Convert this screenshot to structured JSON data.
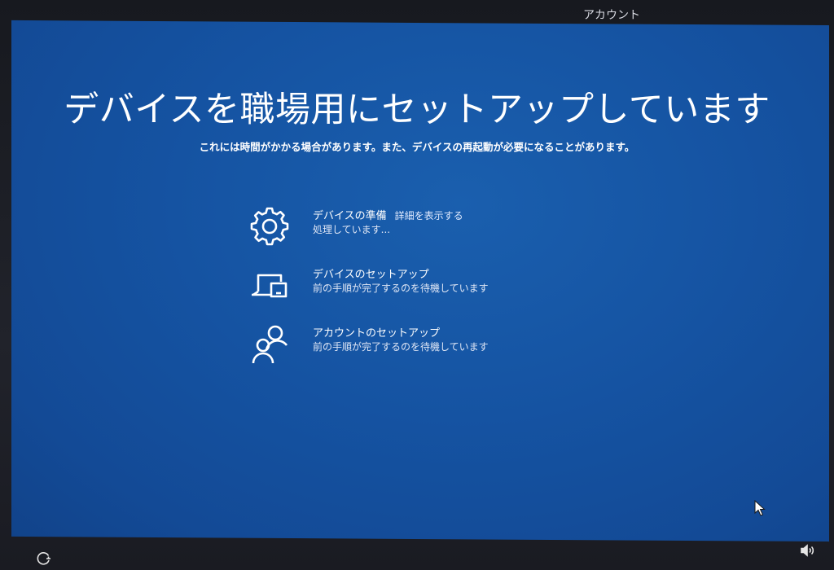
{
  "header": {
    "active_tab": "アカウント"
  },
  "main": {
    "title": "デバイスを職場用にセットアップしています",
    "subtitle": "これには時間がかかる場合があります。また、デバイスの再起動が必要になることがあります。"
  },
  "steps": [
    {
      "icon": "gear-icon",
      "title": "デバイスの準備",
      "link": "詳細を表示する",
      "status": "処理しています..."
    },
    {
      "icon": "devices-icon",
      "title": "デバイスのセットアップ",
      "status": "前の手順が完了するのを待機しています"
    },
    {
      "icon": "people-icon",
      "title": "アカウントのセットアップ",
      "status": "前の手順が完了するのを待機しています"
    }
  ],
  "footer": {
    "left_icon": "ease-of-access-icon",
    "right_icon": "volume-icon"
  },
  "colors": {
    "screen_blue": "#1553a2",
    "text": "#ffffff"
  }
}
